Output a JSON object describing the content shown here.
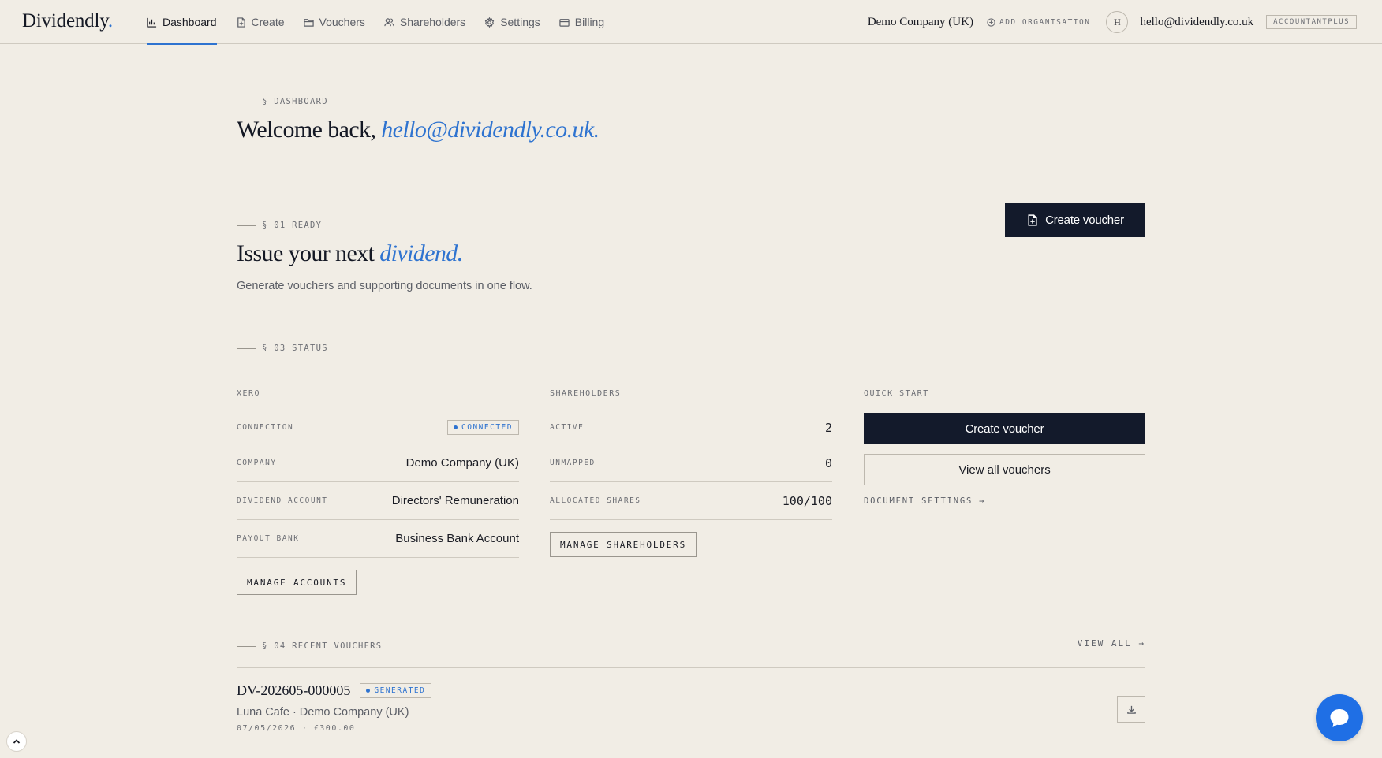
{
  "brand": {
    "logo_text": "Dividendly",
    "logo_dot": ".",
    "accent_color": "#2e73d0"
  },
  "nav": {
    "items": [
      {
        "label": "Dashboard",
        "icon": "bar-chart-icon",
        "active": true
      },
      {
        "label": "Create",
        "icon": "file-plus-icon"
      },
      {
        "label": "Vouchers",
        "icon": "folder-icon"
      },
      {
        "label": "Shareholders",
        "icon": "users-icon"
      },
      {
        "label": "Settings",
        "icon": "gear-icon"
      },
      {
        "label": "Billing",
        "icon": "credit-card-icon"
      }
    ],
    "organisation": "Demo Company (UK)",
    "add_organisation": "ADD ORGANISATION",
    "avatar_initial": "H",
    "user_email": "hello@dividendly.co.uk",
    "plan": "ACCOUNTANTPLUS"
  },
  "dashboard": {
    "eyebrow": "§ DASHBOARD",
    "welcome_prefix": "Welcome back,",
    "welcome_email": "hello@dividendly.co.uk."
  },
  "ready": {
    "eyebrow": "§ 01 READY",
    "title_prefix": "Issue your next",
    "title_accent": "dividend.",
    "subtitle": "Generate vouchers and supporting documents in one flow.",
    "create_button": "Create voucher"
  },
  "status": {
    "eyebrow": "§ 03 STATUS",
    "xero": {
      "heading": "XERO",
      "connection_label": "CONNECTION",
      "connection_status": "CONNECTED",
      "company_label": "COMPANY",
      "company_value": "Demo Company (UK)",
      "dividend_account_label": "DIVIDEND ACCOUNT",
      "dividend_account_value": "Directors' Remuneration",
      "payout_bank_label": "PAYOUT BANK",
      "payout_bank_value": "Business Bank Account",
      "manage_button": "MANAGE ACCOUNTS"
    },
    "shareholders": {
      "heading": "SHAREHOLDERS",
      "active_label": "ACTIVE",
      "active_value": "2",
      "unmapped_label": "UNMAPPED",
      "unmapped_value": "0",
      "allocated_label": "ALLOCATED SHARES",
      "allocated_value": "100/100",
      "manage_button": "MANAGE SHAREHOLDERS"
    },
    "quick_start": {
      "heading": "QUICK START",
      "create_button": "Create voucher",
      "view_button": "View all vouchers",
      "doc_settings_link": "DOCUMENT SETTINGS →"
    }
  },
  "recent": {
    "eyebrow": "§ 04 RECENT VOUCHERS",
    "view_all": "VIEW ALL →",
    "vouchers": [
      {
        "id": "DV-202605-000005",
        "status": "GENERATED",
        "subtitle": "Luna Cafe · Demo Company (UK)",
        "meta": "07/05/2026 · £300.00"
      }
    ]
  }
}
